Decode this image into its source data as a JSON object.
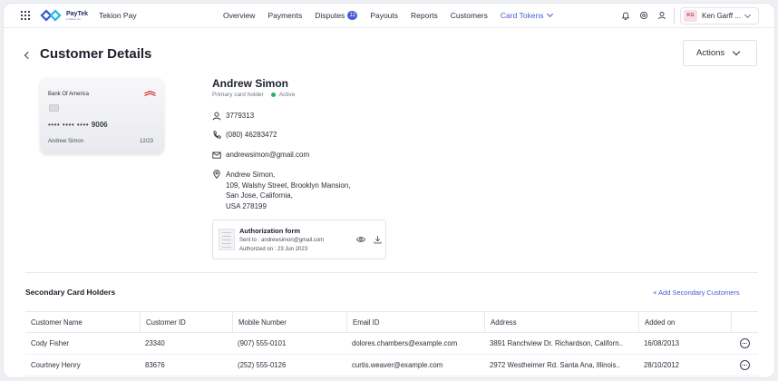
{
  "app": {
    "brand": "Tekion Pay",
    "logo_text": "PayTek",
    "logo_sub": "a Tekion Co"
  },
  "nav": {
    "links": [
      "Overview",
      "Payments",
      "Disputes",
      "Payouts",
      "Reports",
      "Customers",
      "Card Tokens"
    ],
    "disputes_count": "12",
    "active": "Card Tokens"
  },
  "user": {
    "initials": "KG",
    "name": "Ken Garff ..."
  },
  "header": {
    "title": "Customer Details",
    "actions_label": "Actions"
  },
  "card": {
    "bank": "Bank Of America",
    "masked": "•••• •••• ••••",
    "last4": "9006",
    "holder": "Andrew Simon",
    "expiry": "12/23"
  },
  "customer": {
    "name": "Andrew Simon",
    "role": "Primary card holder",
    "status": "Active",
    "id": "3779313",
    "phone": "(080) 46283472",
    "email": "andrewsimon@gmail.com",
    "address_lines": [
      "Andrew Simon,",
      "109, Walshy Street, Brooklyn Mansion,",
      "San Jose, California,",
      "USA 278199"
    ]
  },
  "auth_form": {
    "title": "Authorization form",
    "sent_to": "Sent to : andrewsimon@gmail.com",
    "authorized_on": "Authorized on : 23 Jun 2023"
  },
  "secondary": {
    "title": "Secondary Card Holders",
    "add_label": "+ Add Secondary Customers",
    "columns": [
      "Customer Name",
      "Customer ID",
      "Mobile Number",
      "Email ID",
      "Address",
      "Added on"
    ],
    "rows": [
      [
        "Cody Fisher",
        "23340",
        "(907) 555-0101",
        "dolores.chambers@example.com",
        "3891 Ranchview Dr. Richardson, Californ..",
        "16/08/2013"
      ],
      [
        "Courtney Henry",
        "83676",
        "(252) 555-0126",
        "curtis.weaver@example.com",
        "2972 Westheimer Rd. Santa Ana, Illinois..",
        "28/10/2012"
      ]
    ]
  },
  "colors": {
    "accent": "#4b5bd6",
    "status_active": "#1fb36b",
    "avatar_bg": "#f9dfe7"
  }
}
